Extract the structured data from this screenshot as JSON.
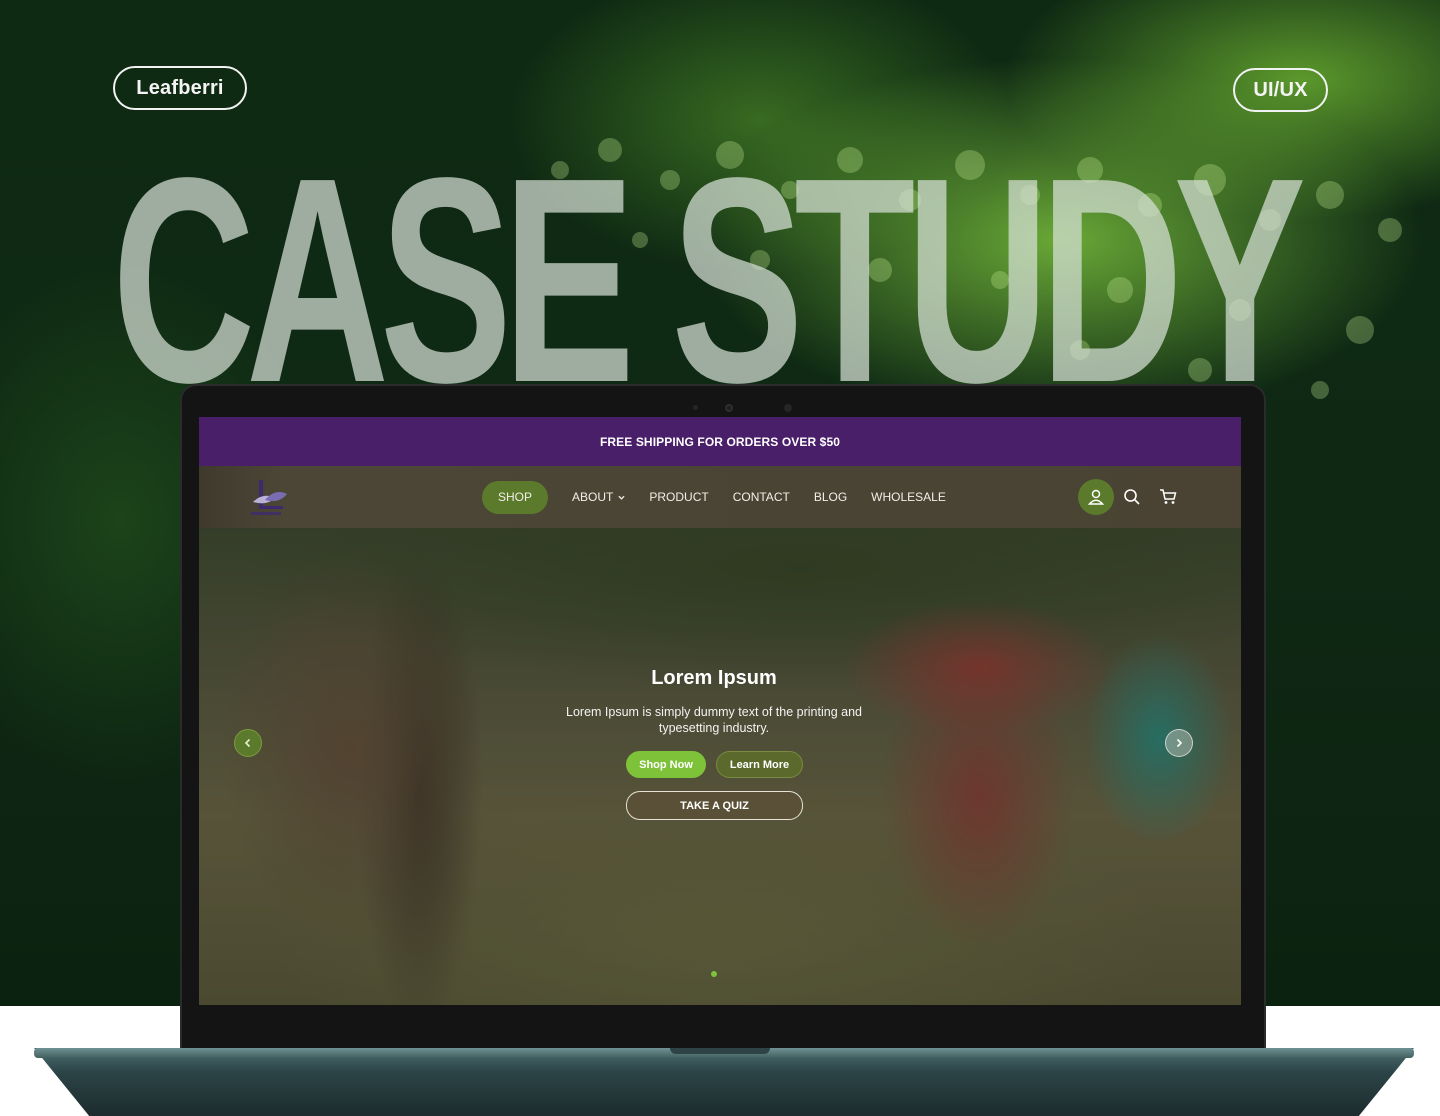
{
  "cover": {
    "brand_pill": "Leafberri",
    "tag_pill": "UI/UX",
    "headline": "CASE STUDY"
  },
  "website": {
    "promo_bar": "FREE SHIPPING FOR ORDERS OVER $50",
    "nav": {
      "items": [
        {
          "label": "SHOP",
          "active": true
        },
        {
          "label": "ABOUT",
          "has_dropdown": true
        },
        {
          "label": "PRODUCT"
        },
        {
          "label": "CONTACT"
        },
        {
          "label": "BLOG"
        },
        {
          "label": "WHOLESALE"
        }
      ],
      "icons": [
        "user-icon",
        "search-icon",
        "cart-icon"
      ]
    },
    "hero": {
      "title": "Lorem Ipsum",
      "subtitle": "Lorem Ipsum is simply dummy text of the printing and typesetting industry.",
      "shop_button": "Shop Now",
      "learn_button": "Learn More",
      "quiz_button": "TAKE A QUIZ"
    },
    "colors": {
      "promo_bar": "#4a1f6a",
      "accent_green": "#7ec23a",
      "nav_active": "#5b7a2b"
    }
  }
}
